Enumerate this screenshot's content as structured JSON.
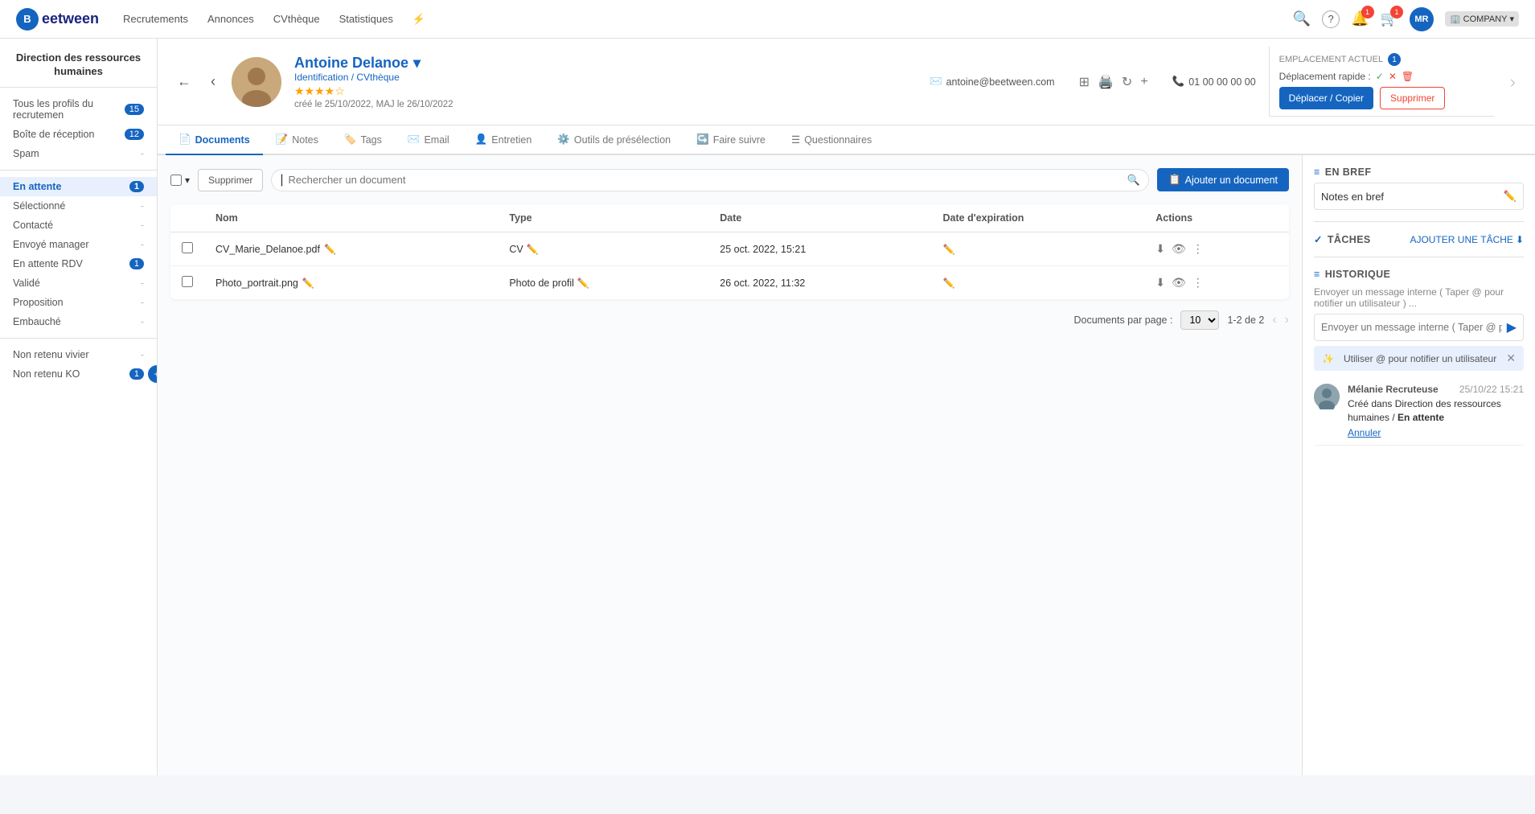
{
  "app": {
    "logo_letter": "B",
    "logo_text": "eetween"
  },
  "topnav": {
    "menu_items": [
      {
        "label": "Recrutements",
        "id": "recrutements"
      },
      {
        "label": "Annonces",
        "id": "annonces"
      },
      {
        "label": "CVthèque",
        "id": "cvtheque"
      },
      {
        "label": "Statistiques",
        "id": "statistiques"
      },
      {
        "label": "⚡",
        "id": "flash"
      }
    ],
    "icons": {
      "search": "🔍",
      "help": "?",
      "bell": "🔔",
      "bell_badge": "1",
      "cart": "🛒",
      "avatar": "MR"
    },
    "company": "COMPANY"
  },
  "sidebar": {
    "title": "Direction des ressources humaines",
    "items": [
      {
        "label": "Tous les profils du recrutemen",
        "count": "15",
        "active": false
      },
      {
        "label": "Boîte de réception",
        "count": "12",
        "active": false
      },
      {
        "label": "Spam",
        "count": "-",
        "active": false
      },
      {
        "label": "En attente",
        "count": "1",
        "active": true
      },
      {
        "label": "Sélectionné",
        "count": "-",
        "active": false
      },
      {
        "label": "Contacté",
        "count": "-",
        "active": false
      },
      {
        "label": "Envoyé manager",
        "count": "-",
        "active": false
      },
      {
        "label": "En attente RDV",
        "count": "1",
        "active": false
      },
      {
        "label": "Validé",
        "count": "-",
        "active": false
      },
      {
        "label": "Proposition",
        "count": "-",
        "active": false
      },
      {
        "label": "Embauché",
        "count": "-",
        "active": false
      },
      {
        "label": "Non retenu vivier",
        "count": "-",
        "active": false
      },
      {
        "label": "Non retenu KO",
        "count": "1",
        "active": false
      }
    ]
  },
  "candidate": {
    "name": "Antoine Delanoe",
    "link_label": "Identification / CVthèque",
    "email": "antoine@beetween.com",
    "phone": "01 00 00 00 00",
    "created": "créé le 25/10/2022, MAJ le 26/10/2022",
    "stars": 4,
    "star_full": "★",
    "star_empty": "☆"
  },
  "placement": {
    "title": "EMPLACEMENT ACTUEL",
    "badge": "1",
    "quick_label": "Déplacement rapide :",
    "btn_move": "Déplacer / Copier",
    "btn_delete": "Supprimer"
  },
  "tabs": [
    {
      "label": "Documents",
      "icon": "📄",
      "active": true
    },
    {
      "label": "Notes",
      "icon": "📝",
      "active": false
    },
    {
      "label": "Tags",
      "icon": "🏷️",
      "active": false
    },
    {
      "label": "Email",
      "icon": "✉️",
      "active": false
    },
    {
      "label": "Entretien",
      "icon": "👤",
      "active": false
    },
    {
      "label": "Outils de présélection",
      "icon": "⚙️",
      "active": false
    },
    {
      "label": "Faire suivre",
      "icon": "↪️",
      "active": false
    },
    {
      "label": "Questionnaires",
      "icon": "☰",
      "active": false
    }
  ],
  "documents": {
    "search_placeholder": "Rechercher un document",
    "btn_delete": "Supprimer",
    "btn_add": "Ajouter un document",
    "columns": [
      "",
      "Nom",
      "Type",
      "Date",
      "Date d'expiration",
      "Actions"
    ],
    "rows": [
      {
        "name": "CV_Marie_Delanoe.pdf",
        "type": "CV",
        "date": "25 oct. 2022, 15:21",
        "expiry": "",
        "actions": [
          "download",
          "view",
          "more"
        ]
      },
      {
        "name": "Photo_portrait.png",
        "type": "Photo de profil",
        "date": "26 oct. 2022, 11:32",
        "expiry": "",
        "actions": [
          "download",
          "view",
          "more"
        ]
      }
    ],
    "pagination": {
      "per_page_label": "Documents par page :",
      "per_page_value": "10",
      "range": "1-2 de 2"
    }
  },
  "right_panel": {
    "en_bref": {
      "title": "EN BREF",
      "notes_label": "Notes en bref"
    },
    "taches": {
      "title": "TÂCHES",
      "add_label": "AJOUTER UNE TÂCHE"
    },
    "historique": {
      "title": "HISTORIQUE",
      "input_placeholder": "Envoyer un message interne ( Taper @ pour notifier un utilisateur ) ...",
      "hint": "Utiliser @ pour notifier un utilisateur",
      "entry": {
        "name": "Mélanie Recruteuse",
        "time": "25/10/22 15:21",
        "text_before": "Créé dans Direction des ressources humaines / ",
        "text_bold": "En attente",
        "cancel_label": "Annuler"
      }
    }
  }
}
